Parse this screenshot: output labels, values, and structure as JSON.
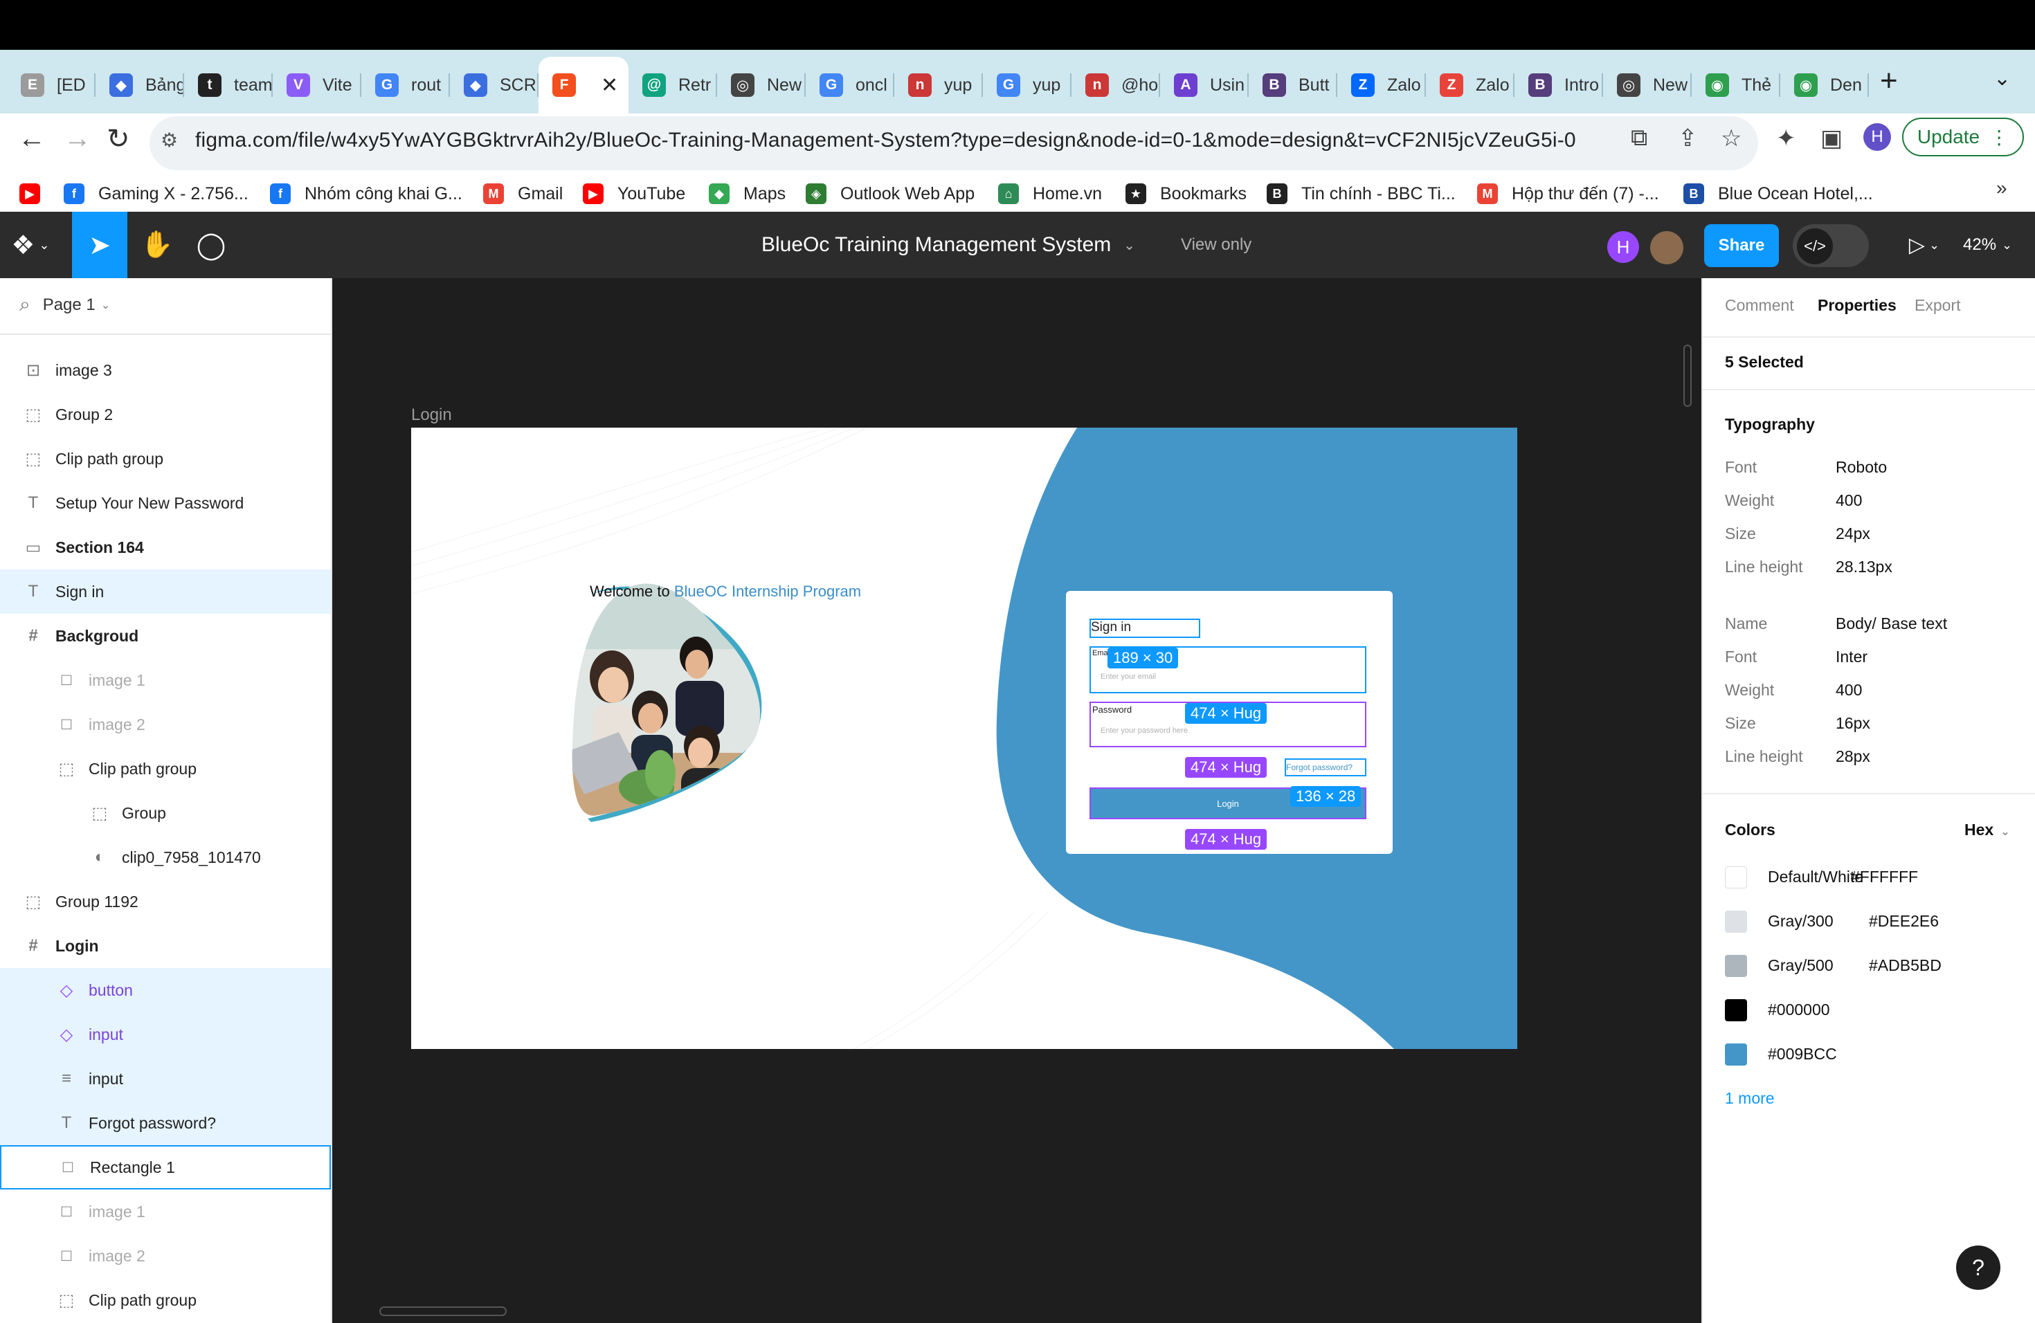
{
  "browser": {
    "tabs": [
      {
        "icon_text": "E",
        "label": "[ED",
        "color": "#9b9b9b"
      },
      {
        "icon_text": "◆",
        "label": "Bảng",
        "color": "#3b6fe0"
      },
      {
        "icon_text": "t",
        "label": "team",
        "color": "#222222"
      },
      {
        "icon_text": "V",
        "label": "Vite",
        "color": "#8b5cf6"
      },
      {
        "icon_text": "G",
        "label": "rout",
        "color": "#4285f4"
      },
      {
        "icon_text": "◆",
        "label": "SCR",
        "color": "#3b6fe0"
      },
      {
        "icon_text": "F",
        "label": "",
        "color": "#f24e1e",
        "active": true
      },
      {
        "icon_text": "@",
        "label": "Retr",
        "color": "#10a37f"
      },
      {
        "icon_text": "◎",
        "label": "New",
        "color": "#444444"
      },
      {
        "icon_text": "G",
        "label": "oncl",
        "color": "#4285f4"
      },
      {
        "icon_text": "n",
        "label": "yup",
        "color": "#cb3837"
      },
      {
        "icon_text": "G",
        "label": "yup",
        "color": "#4285f4"
      },
      {
        "icon_text": "n",
        "label": "@ho",
        "color": "#cb3837"
      },
      {
        "icon_text": "A",
        "label": "Usin",
        "color": "#6c3fd1"
      },
      {
        "icon_text": "B",
        "label": "Butt",
        "color": "#563d7c"
      },
      {
        "icon_text": "Z",
        "label": "Zalo",
        "color": "#0068ff"
      },
      {
        "icon_text": "Z",
        "label": "Zalo",
        "color": "#e8433a"
      },
      {
        "icon_text": "B",
        "label": "Intro",
        "color": "#563d7c"
      },
      {
        "icon_text": "◎",
        "label": "New",
        "color": "#444444"
      },
      {
        "icon_text": "◉",
        "label": "Thẻ",
        "color": "#2e9e4f"
      },
      {
        "icon_text": "◉",
        "label": "Den",
        "color": "#2e9e4f"
      }
    ],
    "new_tab": "+",
    "tab_menu": "⌄",
    "url": "figma.com/file/w4xy5YwAYGBGktrvrAih2y/BlueOc-Training-Management-System?type=design&node-id=0-1&mode=design&t=vCF2NI5jcVZeuG5i-0",
    "profile_initial": "H",
    "update_label": "Update",
    "bookmarks": [
      {
        "label": "",
        "icon_text": "▶",
        "color": "#ff0000"
      },
      {
        "label": "Gaming X - 2.756...",
        "icon_text": "f",
        "color": "#1877f2"
      },
      {
        "label": "Nhóm công khai G...",
        "icon_text": "f",
        "color": "#1877f2"
      },
      {
        "label": "Gmail",
        "icon_text": "M",
        "color": "#ea4335"
      },
      {
        "label": "YouTube",
        "icon_text": "▶",
        "color": "#ff0000"
      },
      {
        "label": "Maps",
        "icon_text": "◆",
        "color": "#34a853"
      },
      {
        "label": "Outlook Web App",
        "icon_text": "◈",
        "color": "#2e7d32"
      },
      {
        "label": "Home.vn",
        "icon_text": "⌂",
        "color": "#2e8b57"
      },
      {
        "label": "Bookmarks",
        "icon_text": "★",
        "color": "#222222"
      },
      {
        "label": "Tin chính - BBC Ti...",
        "icon_text": "B",
        "color": "#222222"
      },
      {
        "label": "Hộp thư đến (7) -...",
        "icon_text": "M",
        "color": "#ea4335"
      },
      {
        "label": "Blue Ocean Hotel,...",
        "icon_text": "B",
        "color": "#1d4ea8"
      }
    ],
    "bookmarks_more": "»"
  },
  "figma": {
    "file_title": "BlueOc Training Management System",
    "view_mode": "View only",
    "avatar_initial": "H",
    "share_label": "Share",
    "dev_mode_icon": "</>",
    "zoom": "42%",
    "page_selector": "Page 1",
    "layers": [
      {
        "label": "image 3",
        "icon": "image-icon",
        "glyph": "⊡",
        "indent": 0
      },
      {
        "label": "Group 2",
        "icon": "group-icon",
        "glyph": "⬚",
        "indent": 0
      },
      {
        "label": "Clip path group",
        "icon": "group-icon",
        "glyph": "⬚",
        "indent": 0
      },
      {
        "label": "Setup Your New Password",
        "icon": "text-icon",
        "glyph": "T",
        "indent": 0
      },
      {
        "label": "Section 164",
        "icon": "section-icon",
        "glyph": "▭",
        "indent": 0,
        "bold": true
      },
      {
        "label": "Sign in",
        "icon": "text-icon",
        "glyph": "T",
        "indent": 0,
        "highlight": true
      },
      {
        "label": "Backgroud",
        "icon": "frame-icon",
        "glyph": "#",
        "indent": 0,
        "bold": true
      },
      {
        "label": "image 1",
        "icon": "rectangle-icon",
        "glyph": "□",
        "indent": 1,
        "dim": true
      },
      {
        "label": "image 2",
        "icon": "rectangle-icon",
        "glyph": "□",
        "indent": 1,
        "dim": true
      },
      {
        "label": "Clip path group",
        "icon": "group-icon",
        "glyph": "⬚",
        "indent": 1
      },
      {
        "label": "Group",
        "icon": "group-icon",
        "glyph": "⬚",
        "indent": 2
      },
      {
        "label": "clip0_7958_101470",
        "icon": "mask-icon",
        "glyph": "◐",
        "indent": 2
      },
      {
        "label": "Group 1192",
        "icon": "group-icon",
        "glyph": "⬚",
        "indent": 0
      },
      {
        "label": "Login",
        "icon": "frame-icon",
        "glyph": "#",
        "indent": 0,
        "bold": true
      },
      {
        "label": "button",
        "icon": "component-icon",
        "glyph": "◇",
        "indent": 1,
        "highlight": true,
        "purple": true
      },
      {
        "label": "input",
        "icon": "component-icon",
        "glyph": "◇",
        "indent": 1,
        "highlight": true,
        "purple": true
      },
      {
        "label": "input",
        "icon": "auto-layout-icon",
        "glyph": "≡",
        "indent": 1,
        "highlight": true
      },
      {
        "label": "Forgot password?",
        "icon": "text-icon",
        "glyph": "T",
        "indent": 1,
        "highlight": true
      },
      {
        "label": "Rectangle 1",
        "icon": "rectangle-icon",
        "glyph": "□",
        "indent": 1,
        "outlined": true
      },
      {
        "label": "image 1",
        "icon": "rectangle-icon",
        "glyph": "□",
        "indent": 1,
        "dim": true
      },
      {
        "label": "image 2",
        "icon": "rectangle-icon",
        "glyph": "□",
        "indent": 1,
        "dim": true
      },
      {
        "label": "Clip path group",
        "icon": "group-icon",
        "glyph": "⬚",
        "indent": 1
      }
    ],
    "canvas": {
      "frame_label": "Login",
      "welcome_prefix": "Welcome to ",
      "welcome_accent": "BlueOC Internship Program",
      "signin_title": "Sign in",
      "email_label": "Ema",
      "email_placeholder": "Enter your email",
      "password_label": "Password",
      "password_placeholder": "Enter your password here",
      "forgot_label": "Forgot password?",
      "login_button": "Login",
      "chip_email": "189 × 30",
      "chip_password": "474 × Hug",
      "chip_forgot": "474 × Hug",
      "chip_button": "136 × 28",
      "chip_bottom": "474 × Hug",
      "brand_blue": "#4496c8"
    },
    "properties": {
      "tabs": [
        "Comment",
        "Properties",
        "Export"
      ],
      "active_tab": "Properties",
      "selection": "5 Selected",
      "typography_heading": "Typography",
      "typography1": [
        {
          "label": "Font",
          "value": "Roboto"
        },
        {
          "label": "Weight",
          "value": "400"
        },
        {
          "label": "Size",
          "value": "24px"
        },
        {
          "label": "Line height",
          "value": "28.13px"
        }
      ],
      "typography2": [
        {
          "label": "Name",
          "value": "Body/ Base text"
        },
        {
          "label": "Font",
          "value": "Inter"
        },
        {
          "label": "Weight",
          "value": "400"
        },
        {
          "label": "Size",
          "value": "16px"
        },
        {
          "label": "Line height",
          "value": "28px"
        }
      ],
      "colors_heading": "Colors",
      "color_format": "Hex",
      "colors": [
        {
          "name": "Default/White",
          "hex": "#FFFFFF",
          "swatch": "#FFFFFF"
        },
        {
          "name": "Gray/300",
          "hex": "#DEE2E6",
          "swatch": "#DEE2E6"
        },
        {
          "name": "Gray/500",
          "hex": "#ADB5BD",
          "swatch": "#ADB5BD"
        },
        {
          "name": "",
          "hex": "#000000",
          "swatch": "#000000"
        },
        {
          "name": "",
          "hex": "#009BCC",
          "swatch": "#4496c8"
        }
      ],
      "more_link": "1 more"
    },
    "help": "?"
  }
}
